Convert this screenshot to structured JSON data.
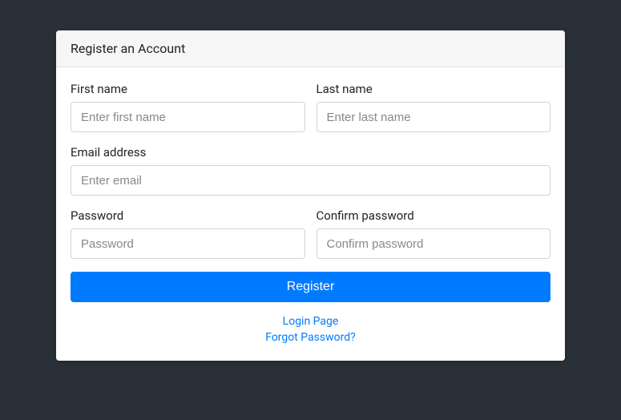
{
  "header": {
    "title": "Register an Account"
  },
  "form": {
    "firstName": {
      "label": "First name",
      "placeholder": "Enter first name",
      "value": ""
    },
    "lastName": {
      "label": "Last name",
      "placeholder": "Enter last name",
      "value": ""
    },
    "email": {
      "label": "Email address",
      "placeholder": "Enter email",
      "value": ""
    },
    "password": {
      "label": "Password",
      "placeholder": "Password",
      "value": ""
    },
    "confirmPassword": {
      "label": "Confirm password",
      "placeholder": "Confirm password",
      "value": ""
    },
    "submit": {
      "label": "Register"
    }
  },
  "links": {
    "login": "Login Page",
    "forgot": "Forgot Password?"
  }
}
